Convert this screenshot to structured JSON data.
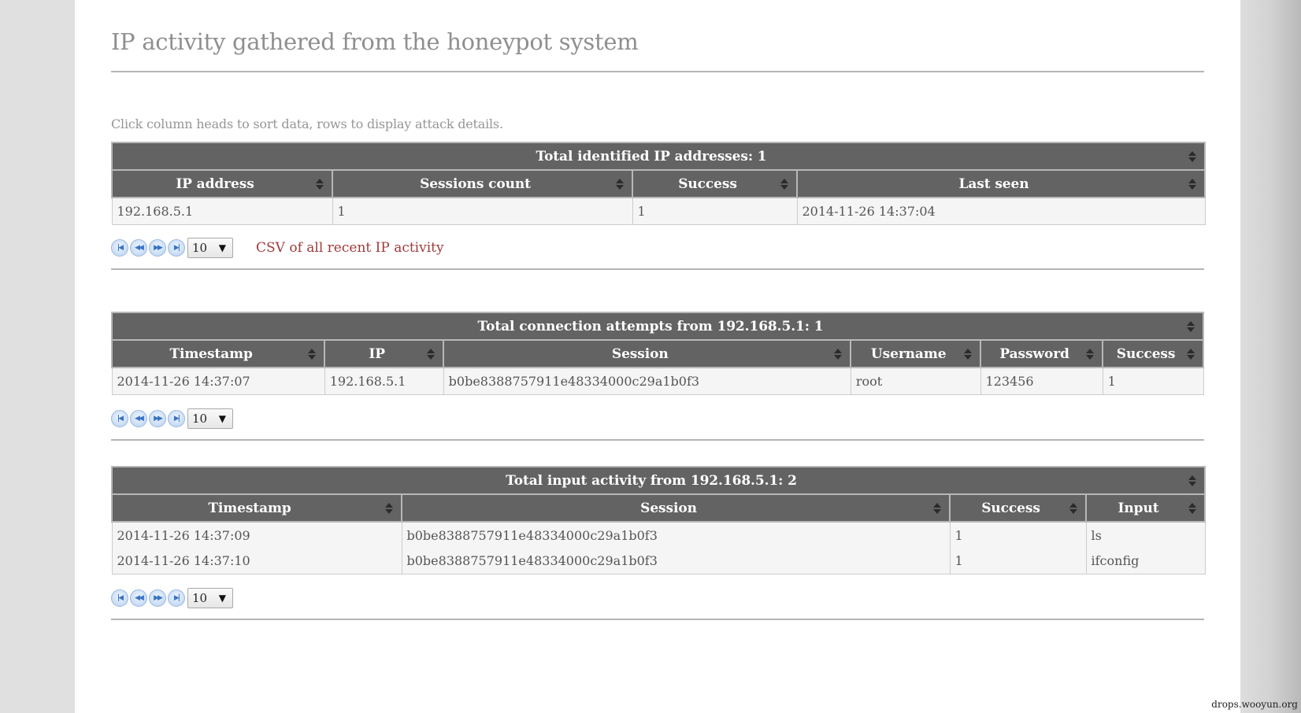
{
  "page": {
    "title": "IP activity gathered from the honeypot system",
    "intro": "Click column heads to sort data, rows to display attack details.",
    "watermark": "drops.wooyun.org"
  },
  "ip_table": {
    "caption": "Total identified IP addresses: 1",
    "columns": [
      "IP address",
      "Sessions count",
      "Success",
      "Last seen"
    ],
    "rows": [
      [
        "192.168.5.1",
        "1",
        "1",
        "2014-11-26 14:37:04"
      ]
    ],
    "pager": {
      "first": "first-page",
      "prev": "prev-page",
      "next": "next-page",
      "last": "last-page",
      "page_size": "10"
    },
    "csv_link": "CSV of all recent IP activity"
  },
  "conn_table": {
    "caption": "Total connection attempts from 192.168.5.1: 1",
    "columns": [
      "Timestamp",
      "IP",
      "Session",
      "Username",
      "Password",
      "Success"
    ],
    "rows": [
      [
        "2014-11-26 14:37:07",
        "192.168.5.1",
        "b0be8388757911e48334000c29a1b0f3",
        "root",
        "123456",
        "1"
      ]
    ],
    "pager": {
      "page_size": "10"
    }
  },
  "input_table": {
    "caption": "Total input activity from 192.168.5.1: 2",
    "columns": [
      "Timestamp",
      "Session",
      "Success",
      "Input"
    ],
    "rows": [
      [
        "2014-11-26 14:37:09",
        "b0be8388757911e48334000c29a1b0f3",
        "1",
        "ls"
      ],
      [
        "2014-11-26 14:37:10",
        "b0be8388757911e48334000c29a1b0f3",
        "1",
        "ifconfig"
      ]
    ],
    "pager": {
      "page_size": "10"
    }
  },
  "icons": {
    "sort": "sort-both-icon",
    "pager_first": "⏮",
    "pager_prev": "◀◀",
    "pager_next": "▶▶",
    "pager_last": "⏭",
    "select_caret": "▼"
  },
  "colors": {
    "header_bg": "#636363",
    "row_bg": "#f5f5f5",
    "link": "#a03a3a",
    "title": "#8f8f8f"
  }
}
